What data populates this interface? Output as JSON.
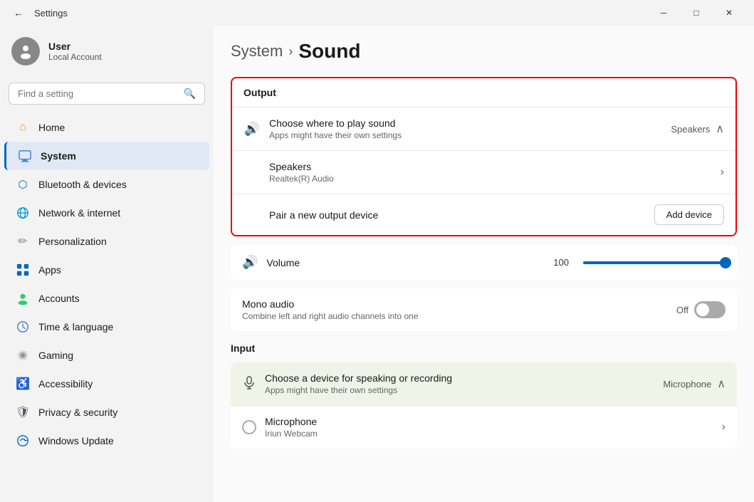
{
  "titlebar": {
    "title": "Settings",
    "minimize": "─",
    "maximize": "□",
    "close": "✕"
  },
  "user": {
    "name": "User",
    "account": "Local Account"
  },
  "search": {
    "placeholder": "Find a setting"
  },
  "nav": {
    "items": [
      {
        "id": "home",
        "label": "Home",
        "icon": "⌂",
        "active": false
      },
      {
        "id": "system",
        "label": "System",
        "icon": "🖥",
        "active": true
      },
      {
        "id": "bluetooth",
        "label": "Bluetooth & devices",
        "icon": "⬡",
        "active": false
      },
      {
        "id": "network",
        "label": "Network & internet",
        "icon": "🌐",
        "active": false
      },
      {
        "id": "personalization",
        "label": "Personalization",
        "icon": "✏",
        "active": false
      },
      {
        "id": "apps",
        "label": "Apps",
        "icon": "🔲",
        "active": false
      },
      {
        "id": "accounts",
        "label": "Accounts",
        "icon": "👤",
        "active": false
      },
      {
        "id": "time",
        "label": "Time & language",
        "icon": "🕐",
        "active": false
      },
      {
        "id": "gaming",
        "label": "Gaming",
        "icon": "⚙",
        "active": false
      },
      {
        "id": "accessibility",
        "label": "Accessibility",
        "icon": "♿",
        "active": false
      },
      {
        "id": "privacy",
        "label": "Privacy & security",
        "icon": "🛡",
        "active": false
      },
      {
        "id": "update",
        "label": "Windows Update",
        "icon": "🔄",
        "active": false
      }
    ]
  },
  "breadcrumb": {
    "system": "System",
    "arrow": "›",
    "current": "Sound"
  },
  "output": {
    "sectionLabel": "Output",
    "chooseDevice": {
      "title": "Choose where to play sound",
      "subtitle": "Apps might have their own settings",
      "current": "Speakers",
      "icon": "🔊"
    },
    "speakers": {
      "title": "Speakers",
      "subtitle": "Realtek(R) Audio"
    },
    "pairDevice": {
      "label": "Pair a new output device",
      "button": "Add device"
    }
  },
  "volume": {
    "label": "Volume",
    "value": "100",
    "icon": "🔊"
  },
  "mono": {
    "title": "Mono audio",
    "subtitle": "Combine left and right audio channels into one",
    "state": "Off"
  },
  "input": {
    "sectionLabel": "Input",
    "chooseDevice": {
      "title": "Choose a device for speaking or recording",
      "subtitle": "Apps might have their own settings",
      "current": "Microphone"
    },
    "microphone": {
      "title": "Microphone",
      "subtitle": "Iriun Webcam"
    }
  }
}
